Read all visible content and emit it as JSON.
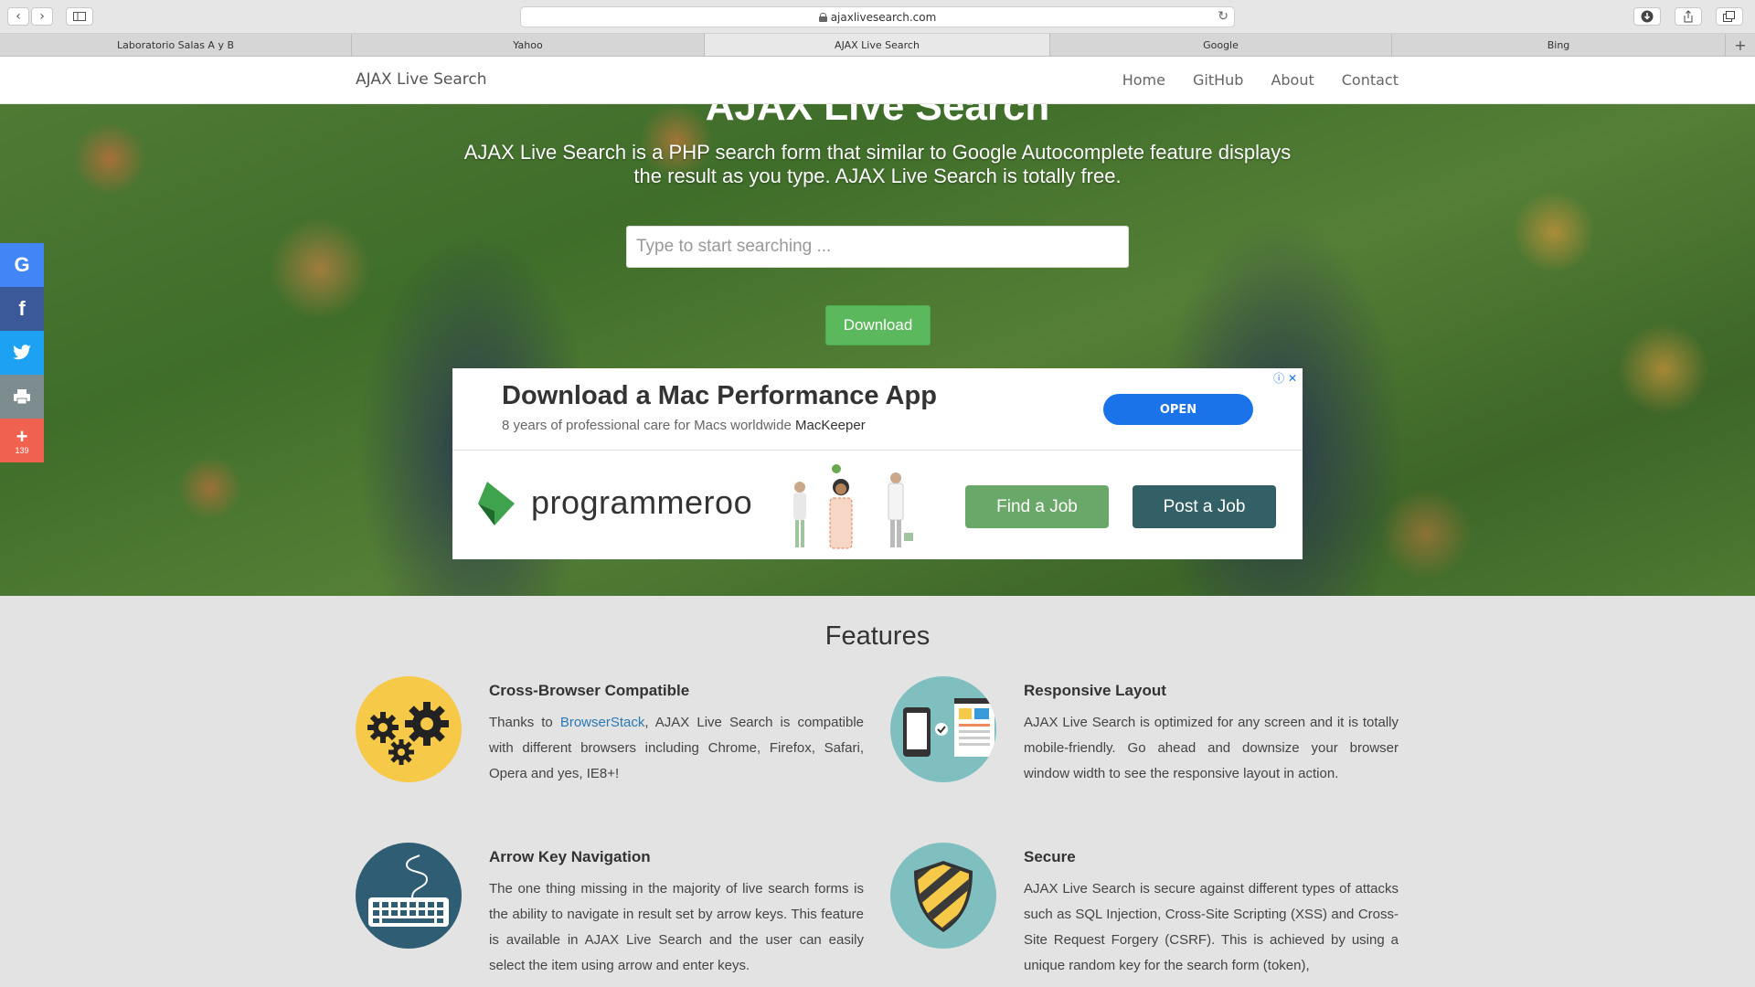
{
  "browser": {
    "url": "ajaxlivesearch.com",
    "tabs": [
      {
        "label": "Laboratorio Salas A y B"
      },
      {
        "label": "Yahoo"
      },
      {
        "label": "AJAX Live Search"
      },
      {
        "label": "Google"
      },
      {
        "label": "Bing"
      }
    ]
  },
  "navbar": {
    "brand": "AJAX Live Search",
    "items": [
      {
        "label": "Home"
      },
      {
        "label": "GitHub"
      },
      {
        "label": "About"
      },
      {
        "label": "Contact"
      }
    ]
  },
  "hero": {
    "title": "AJAX Live Search",
    "description": "AJAX Live Search is a PHP search form that similar to Google Autocomplete feature displays the result as you type. AJAX Live Search is totally free.",
    "search_placeholder": "Type to start searching ...",
    "download_label": "Download"
  },
  "ad": {
    "headline": "Download a Mac Performance App",
    "subtitle": "8 years of professional care for Macs worldwide",
    "advertiser": "MacKeeper",
    "open_label": "OPEN",
    "brand": "programmeroo",
    "find_label": "Find a Job",
    "post_label": "Post a Job"
  },
  "social": {
    "share_count": "139",
    "colors": {
      "google": "#4285f4",
      "facebook": "#3b5998",
      "twitter": "#1da1f2",
      "print": "#7d8c8e",
      "more": "#f0614f"
    }
  },
  "features": {
    "title": "Features",
    "items": [
      {
        "heading": "Cross-Browser Compatible",
        "text_before": "Thanks to ",
        "link": "BrowserStack",
        "text_after": ", AJAX Live Search is compatible with different browsers including Chrome, Firefox, Safari, Opera and yes, IE8+!"
      },
      {
        "heading": "Responsive Layout",
        "text": "AJAX Live Search is optimized for any screen and it is totally mobile-friendly. Go ahead and downsize your browser window width to see the responsive layout in action."
      },
      {
        "heading": "Arrow Key Navigation",
        "text": "The one thing missing in the majority of live search forms is the ability to navigate in result set by arrow keys. This feature is available in AJAX Live Search and the user can easily select the item using arrow and enter keys."
      },
      {
        "heading": "Secure",
        "text": "AJAX Live Search is secure against different types of attacks such as SQL Injection, Cross-Site Scripting (XSS) and Cross-Site Request Forgery (CSRF). This is achieved by using a unique random key for the search form (token),"
      }
    ]
  }
}
